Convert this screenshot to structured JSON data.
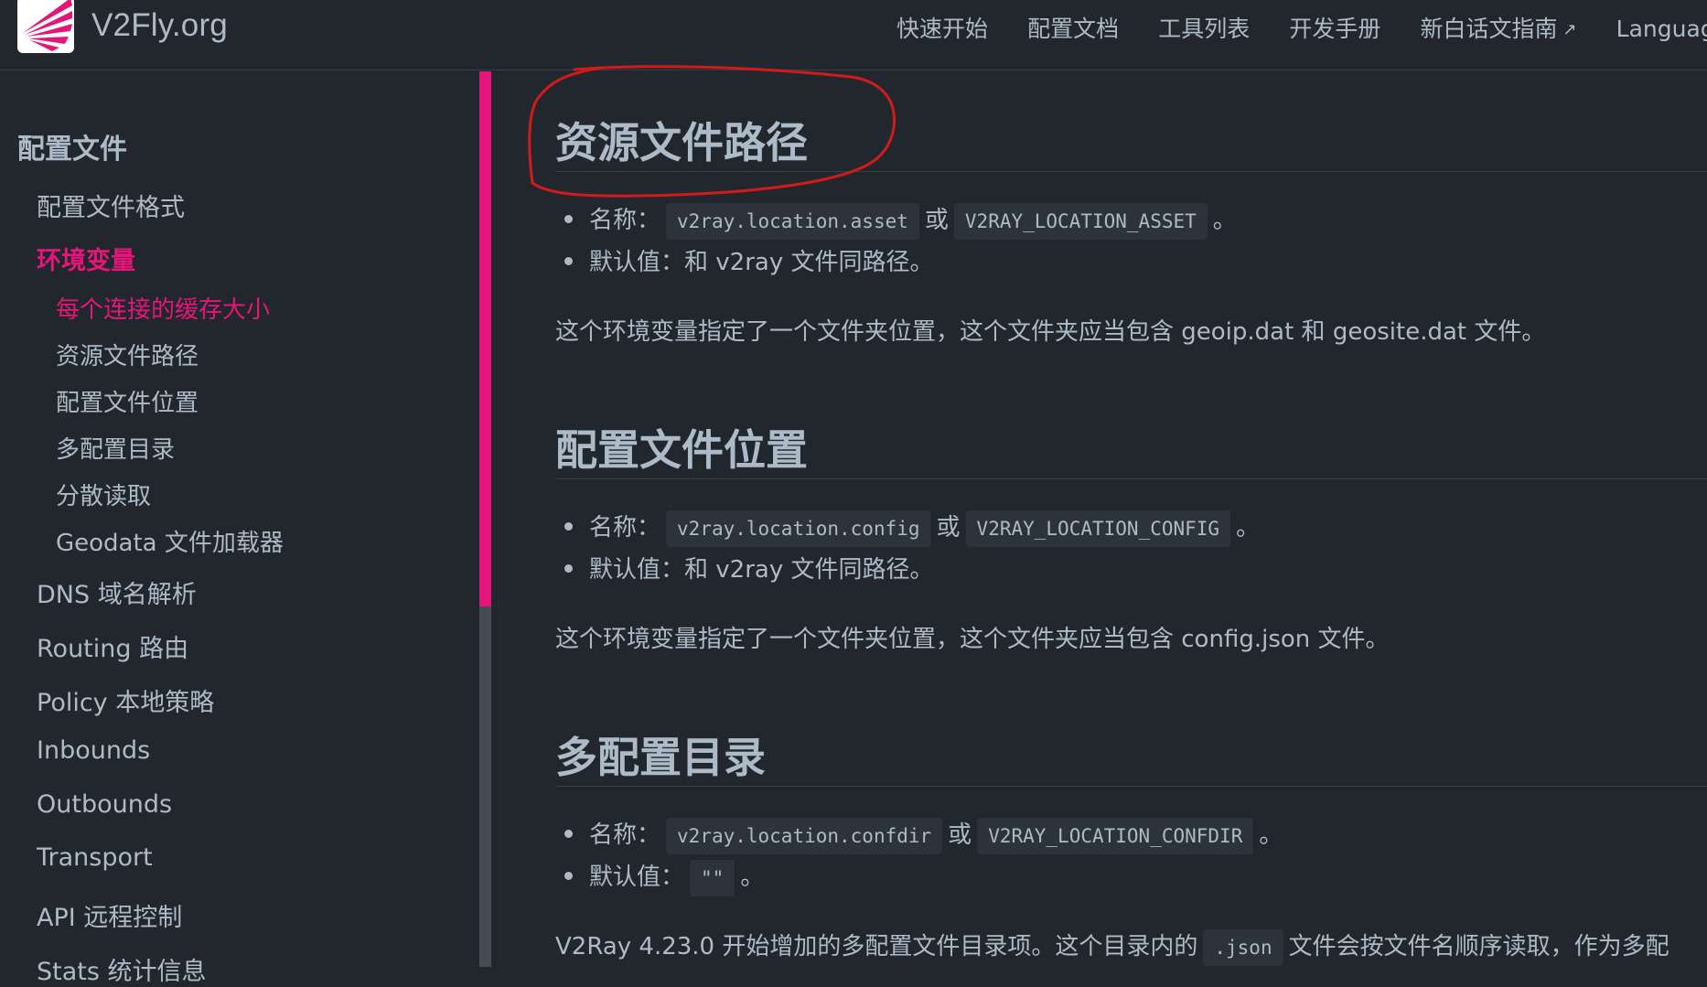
{
  "header": {
    "site_name": "V2Fly.org",
    "nav": [
      "快速开始",
      "配置文档",
      "工具列表",
      "开发手册",
      "新白话文指南",
      "Languag"
    ],
    "external_icon": "↗"
  },
  "sidebar": {
    "heading": "配置文件",
    "items": [
      {
        "label": "配置文件格式"
      },
      {
        "label": "环境变量"
      },
      {
        "label": "每个连接的缓存大小"
      },
      {
        "label": "资源文件路径"
      },
      {
        "label": "配置文件位置"
      },
      {
        "label": "多配置目录"
      },
      {
        "label": "分散读取"
      },
      {
        "label": "Geodata 文件加载器"
      },
      {
        "label": "DNS 域名解析"
      },
      {
        "label": "Routing 路由"
      },
      {
        "label": "Policy 本地策略"
      },
      {
        "label": "Inbounds"
      },
      {
        "label": "Outbounds"
      },
      {
        "label": "Transport"
      },
      {
        "label": "API 远程控制"
      },
      {
        "label": "Stats 统计信息"
      }
    ]
  },
  "content": {
    "sections": [
      {
        "title": "资源文件路径",
        "name_label": "名称：",
        "name_code": "v2ray.location.asset",
        "or": "或",
        "env_code": "V2RAY_LOCATION_ASSET",
        "period": "。",
        "default_text": "默认值：和 v2ray 文件同路径。",
        "desc": "这个环境变量指定了一个文件夹位置，这个文件夹应当包含 geoip.dat 和 geosite.dat 文件。"
      },
      {
        "title": "配置文件位置",
        "name_label": "名称：",
        "name_code": "v2ray.location.config",
        "or": "或",
        "env_code": "V2RAY_LOCATION_CONFIG",
        "period": "。",
        "default_text": "默认值：和 v2ray 文件同路径。",
        "desc": "这个环境变量指定了一个文件夹位置，这个文件夹应当包含 config.json 文件。"
      },
      {
        "title": "多配置目录",
        "name_label": "名称：",
        "name_code": "v2ray.location.confdir",
        "or": "或",
        "env_code": "V2RAY_LOCATION_CONFDIR",
        "period": "。",
        "default_label": "默认值：",
        "default_code": "\"\"",
        "default_period": "。",
        "desc_pre": "V2Ray 4.23.0 开始增加的多配置文件目录项。这个目录内的",
        "desc_code": ".json",
        "desc_post": "文件会按文件名顺序读取，作为多配"
      }
    ]
  },
  "colors": {
    "background": "#22272e",
    "text": "#adbac7",
    "accent": "#e6157a",
    "code_bg": "#2d333b",
    "annotation": "#d11b1b"
  }
}
